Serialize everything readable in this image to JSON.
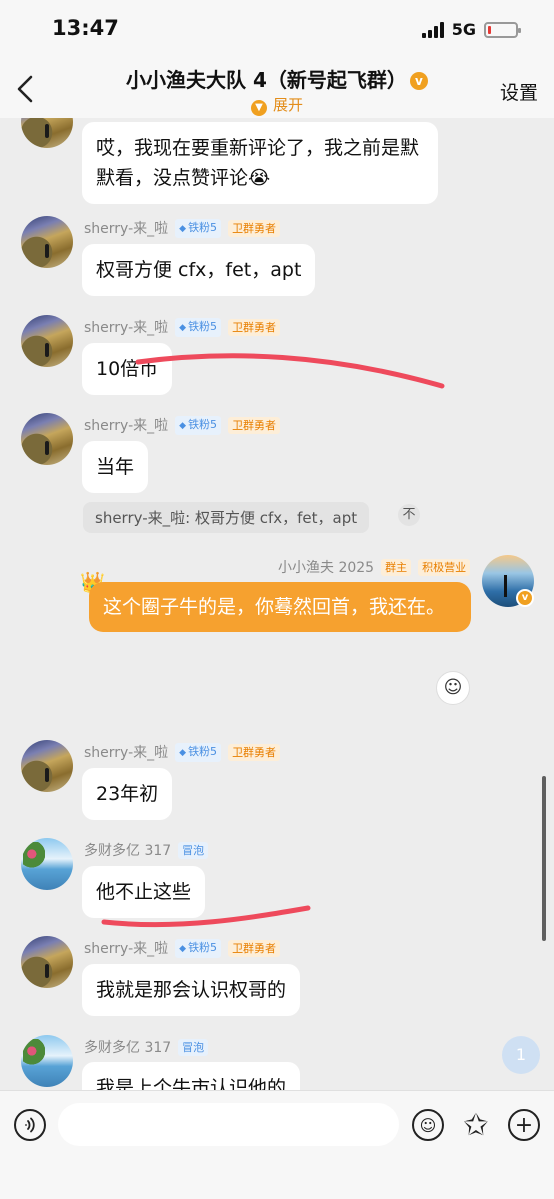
{
  "status_bar": {
    "time": "13:47",
    "network": "5G",
    "battery_level": 0.1,
    "battery_color": "#e53935"
  },
  "header": {
    "title": "小小渔夫大队 4（新号起飞群）",
    "title_badge": "v",
    "subtitle": "展开",
    "settings_label": "设置",
    "accent": "#e38d1a"
  },
  "messages": [
    {
      "id": "m1",
      "text": "哎，我现在要重新评论了，我之前是默默看，没点赞评论😭"
    },
    {
      "id": "m2",
      "sender": "sherry-来_啦",
      "tags": [
        "铁粉5",
        "卫群勇者"
      ],
      "text": "权哥方便 cfx，fet，apt"
    },
    {
      "id": "m3",
      "sender": "sherry-来_啦",
      "tags": [
        "铁粉5",
        "卫群勇者"
      ],
      "text": "10倍币"
    },
    {
      "id": "m4",
      "sender": "sherry-来_啦",
      "tags": [
        "铁粉5",
        "卫群勇者"
      ],
      "text": "当年",
      "quote": "sherry-来_啦: 权哥方便 cfx，fet，apt",
      "quote_icon": "不"
    },
    {
      "id": "m5",
      "sender": "小小渔夫 2025",
      "tags": [
        "群主",
        "积极营业"
      ],
      "text": "这个圈子牛的是，你蓦然回首，我还在。",
      "mine": true,
      "avatar_badge": "v"
    },
    {
      "id": "m6",
      "sender": "sherry-来_啦",
      "tags": [
        "铁粉5",
        "卫群勇者"
      ],
      "text": "23年初"
    },
    {
      "id": "m7",
      "sender": "多财多亿 317",
      "tags": [
        "冒泡"
      ],
      "text": "他不止这些"
    },
    {
      "id": "m8",
      "sender": "sherry-来_啦",
      "tags": [
        "铁粉5",
        "卫群勇者"
      ],
      "text": "我就是那会认识权哥的"
    },
    {
      "id": "m9",
      "sender": "多财多亿 317",
      "tags": [
        "冒泡"
      ],
      "text": "我是上个牛市认识他的"
    }
  ],
  "unread_count": "1",
  "input_bar": {
    "placeholder": "",
    "icons": [
      "voice-icon",
      "emoji-icon",
      "sticker-icon",
      "plus-icon"
    ]
  },
  "colors": {
    "own_bubble": "#f6a12f",
    "annotation_stroke": "#ee4a5c",
    "chat_background": "#ededed"
  }
}
